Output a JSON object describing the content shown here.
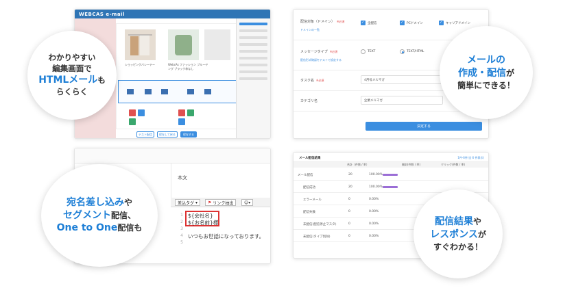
{
  "bubble1": {
    "line1": "わかりやすい",
    "line2": "編集画面で",
    "line3a": "HTMLメール",
    "line3b": "も",
    "line4": "らくらく"
  },
  "bubble2": {
    "line1": "メールの",
    "line2a": "作成・配信",
    "line2b": "が",
    "line3": "簡単にできる！"
  },
  "bubble3": {
    "line1a": "宛名差し込み",
    "line1b": "や",
    "line2a": "セグメント",
    "line2b": "配信、",
    "line3a": "One to One",
    "line3b": "配信も"
  },
  "bubble4": {
    "line1a": "配信結果",
    "line1b": "や",
    "line2a": "レスポンス",
    "line2b": "が",
    "line3": "すぐわかる！"
  },
  "editor": {
    "brand": "WEBCAS e-mail",
    "product_caption_1": "ショッピングバレーテー",
    "product_caption_2": "WebcAs ファッション ブルーヤング ブラック枠なし",
    "bottom_buttons": [
      "テスト配信",
      "保存して戻る",
      "保存する"
    ]
  },
  "form": {
    "target_label": "配信対象（ドメイン）",
    "target_link": "ドメインの一覧",
    "target_options": [
      "全配信",
      "PCドメイン",
      "キャリアドメイン"
    ],
    "msgtype_label": "メッセージタイプ",
    "msgtype_link": "配信形式確認をテストで設定する",
    "msgtype_options": [
      "TEXT",
      "TEXT/HTML"
    ],
    "tag_label": "タスク名",
    "tag_value": "4月号メルマガ",
    "category_label": "カテゴリ名",
    "category_value": "企業メルマガ",
    "required": "※必須",
    "submit": "決定する"
  },
  "code_editor": {
    "section_label": "本文",
    "toolbar": {
      "insert_tag": "差込タグ",
      "link_extract": "リンク抽出"
    },
    "lines": [
      "${会社名}",
      "${お名前}様",
      "",
      "いつもお世話になっております。",
      ""
    ],
    "line_numbers": [
      "1",
      "2",
      "3",
      "4",
      "5"
    ]
  },
  "stats": {
    "title": "メール配信結果",
    "header_link": "1件-6件(全 6 件表示)",
    "col1": "合計（件数 / 率）",
    "col2": "開封(件数 / 率)",
    "col3": "クリック(件数 / 率)",
    "rows": [
      {
        "label": "メール配信",
        "n": "20",
        "pct": "100.00%"
      },
      {
        "label": "配信成功",
        "n": "20",
        "pct": "100.00%"
      },
      {
        "label": "エラーメール",
        "n": "0",
        "pct": "0.00%"
      },
      {
        "label": "配信失敗",
        "n": "0",
        "pct": "0.00%"
      },
      {
        "label": "未配信(配信停止マスタ)",
        "n": "0",
        "pct": "0.00%"
      },
      {
        "label": "未配信(タイプ別除)",
        "n": "0",
        "pct": "0.00%"
      }
    ]
  }
}
